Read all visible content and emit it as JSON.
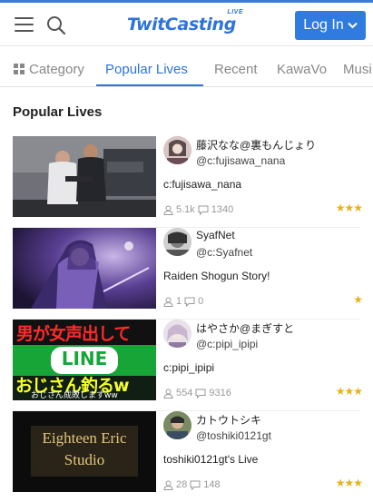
{
  "header": {
    "logo": "TwitCasting",
    "logo_badge": "LIVE",
    "login_label": "Log In"
  },
  "tabs": [
    {
      "label": "Category"
    },
    {
      "label": "Popular Lives"
    },
    {
      "label": "Recent"
    },
    {
      "label": "KawaVo"
    },
    {
      "label": "Musi"
    }
  ],
  "section_title": "Popular Lives",
  "lives": [
    {
      "name": "藤沢なな@裏もんじょり",
      "id": "@c:fujisawa_nana",
      "subtitle": "c:fujisawa_nana",
      "viewers": "5.1k",
      "comments": "1340",
      "stars": "★★★"
    },
    {
      "name": "SyafNet",
      "id": "@c:Syafnet",
      "subtitle": "Raiden Shogun Story!",
      "viewers": "1",
      "comments": "0",
      "stars": "★"
    },
    {
      "name": "はやさか@まぎすと",
      "id": "@c:pipi_ipipi",
      "subtitle": "c:pipi_ipipi",
      "viewers": "554",
      "comments": "9316",
      "stars": "★★★",
      "thumb_text_top": "男が女声出して",
      "thumb_text_mid": "LINE",
      "thumb_text_bottom": "おじさん釣るw",
      "thumb_text_sub": "おじさん成敗しますww"
    },
    {
      "name": "カトウトシキ",
      "id": "@toshiki0121gt",
      "subtitle": "toshiki0121gt's Live",
      "viewers": "28",
      "comments": "148",
      "stars": "★★★",
      "thumb_text_1": "Eighteen Eric",
      "thumb_text_2": "Studio"
    }
  ],
  "colors": {
    "accent": "#2f73d8",
    "login_bg": "#2f7be0",
    "star": "#e5b31e",
    "muted": "#999999"
  }
}
